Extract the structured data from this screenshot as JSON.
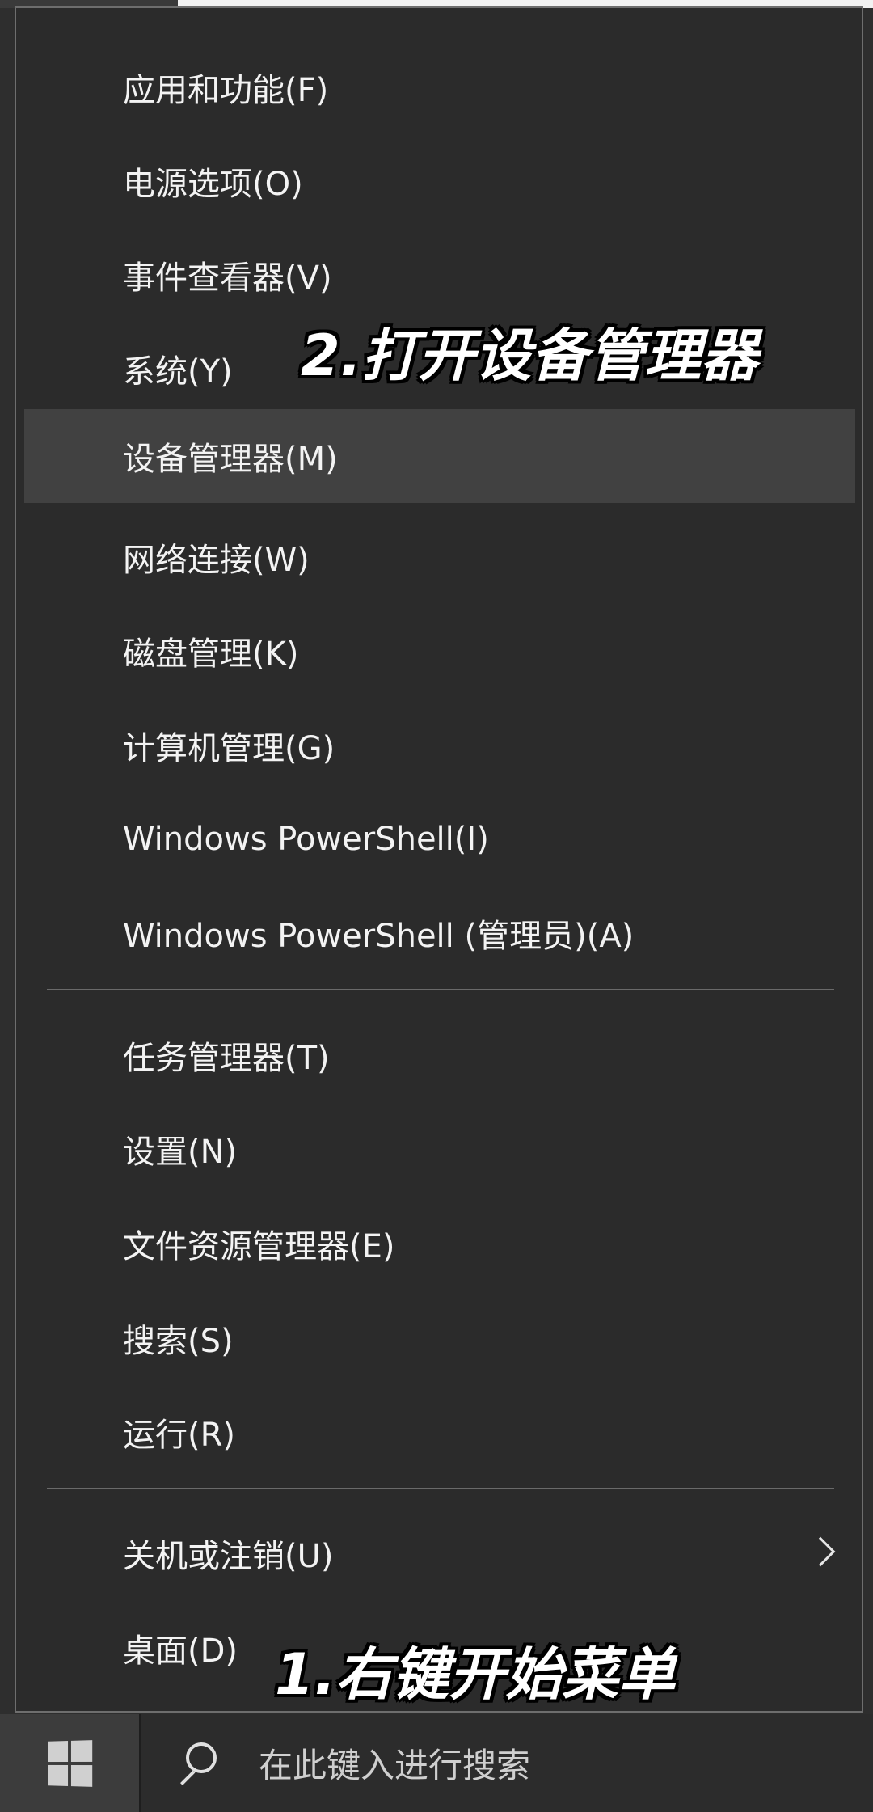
{
  "context_menu": {
    "group1": [
      {
        "label": "应用和功能(F)"
      },
      {
        "label": "电源选项(O)"
      },
      {
        "label": "事件查看器(V)"
      },
      {
        "label": "系统(Y)"
      },
      {
        "label": "设备管理器(M)",
        "highlighted": true
      },
      {
        "label": "网络连接(W)"
      },
      {
        "label": "磁盘管理(K)"
      },
      {
        "label": "计算机管理(G)"
      },
      {
        "label": "Windows PowerShell(I)"
      },
      {
        "label": "Windows PowerShell (管理员)(A)"
      }
    ],
    "group2": [
      {
        "label": "任务管理器(T)"
      },
      {
        "label": "设置(N)"
      },
      {
        "label": "文件资源管理器(E)"
      },
      {
        "label": "搜索(S)"
      },
      {
        "label": "运行(R)"
      }
    ],
    "group3": [
      {
        "label": "关机或注销(U)",
        "has_submenu": true
      },
      {
        "label": "桌面(D)"
      }
    ]
  },
  "annotations": {
    "step2": "2.打开设备管理器",
    "step1": "1.右键开始菜单"
  },
  "taskbar": {
    "start_icon": "windows-logo-icon",
    "search_icon": "search-icon",
    "search_placeholder": "在此键入进行搜索"
  },
  "colors": {
    "menu_bg": "#2b2b2b",
    "highlight_bg": "#414141",
    "text": "#f3f3f3",
    "separator": "#6a6a6a"
  }
}
